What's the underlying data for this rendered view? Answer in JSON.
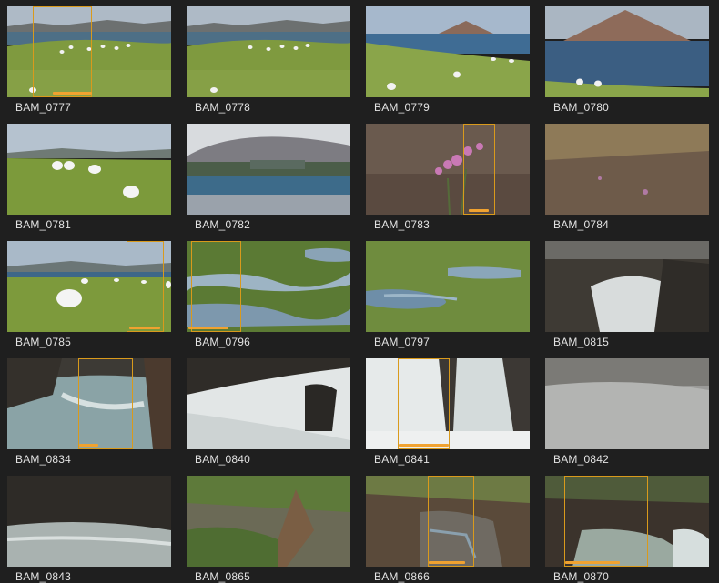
{
  "clips": [
    {
      "name": "BAM_0777"
    },
    {
      "name": "BAM_0778"
    },
    {
      "name": "BAM_0779"
    },
    {
      "name": "BAM_0780"
    },
    {
      "name": "BAM_0781"
    },
    {
      "name": "BAM_0782"
    },
    {
      "name": "BAM_0783"
    },
    {
      "name": "BAM_0784"
    },
    {
      "name": "BAM_0785"
    },
    {
      "name": "BAM_0796"
    },
    {
      "name": "BAM_0797"
    },
    {
      "name": "BAM_0815"
    },
    {
      "name": "BAM_0834"
    },
    {
      "name": "BAM_0840"
    },
    {
      "name": "BAM_0841"
    },
    {
      "name": "BAM_0842"
    },
    {
      "name": "BAM_0843"
    },
    {
      "name": "BAM_0865"
    },
    {
      "name": "BAM_0866"
    },
    {
      "name": "BAM_0870"
    }
  ],
  "colors": {
    "background": "#1f1f1f",
    "selection_border": "#d99a1c",
    "range_bar": "#f0a230",
    "label": "#e3e3e3"
  }
}
